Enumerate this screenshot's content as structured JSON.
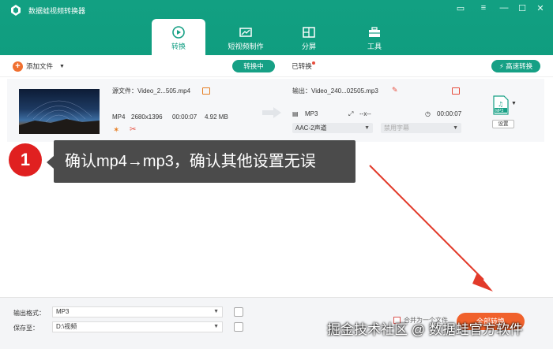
{
  "app": {
    "title": "数据蛙视频转换器"
  },
  "tabs": [
    {
      "label": "转换",
      "icon": "convert-icon"
    },
    {
      "label": "短视频制作",
      "icon": "film-icon"
    },
    {
      "label": "分屏",
      "icon": "split-screen-icon"
    },
    {
      "label": "工具",
      "icon": "toolbox-icon"
    }
  ],
  "toolbar": {
    "add_file": "添加文件",
    "converting": "转换中",
    "converted": "已转换",
    "fast_convert": "高速转换"
  },
  "file": {
    "source": "源文件：Video_2...505.mp4",
    "format": "MP4",
    "resolution": "2680x1396",
    "duration": "00:00:07",
    "size": "4.92 MB",
    "output": "输出：Video_240...02505.mp3",
    "out_format": "MP3",
    "out_resolution": "--x--",
    "out_duration": "00:00:07",
    "audio": "AAC-2声道",
    "subtitle": "禁用字幕",
    "settings": "设置",
    "format_badge": "MP3"
  },
  "callout": {
    "number": "1",
    "text": "确认mp4→mp3，确认其他设置无误"
  },
  "bottom": {
    "format_label": "输出格式：",
    "format_value": "MP3",
    "save_label": "保存至：",
    "save_value": "D:\\视频",
    "merge": "合并为一个文件",
    "convert_all": "全部转换"
  },
  "watermark": "掘金技术社区 @ 数据蛙官方软件",
  "colors": {
    "brand": "#16a085",
    "accent": "#f0612c",
    "callout_red": "#e02020"
  }
}
